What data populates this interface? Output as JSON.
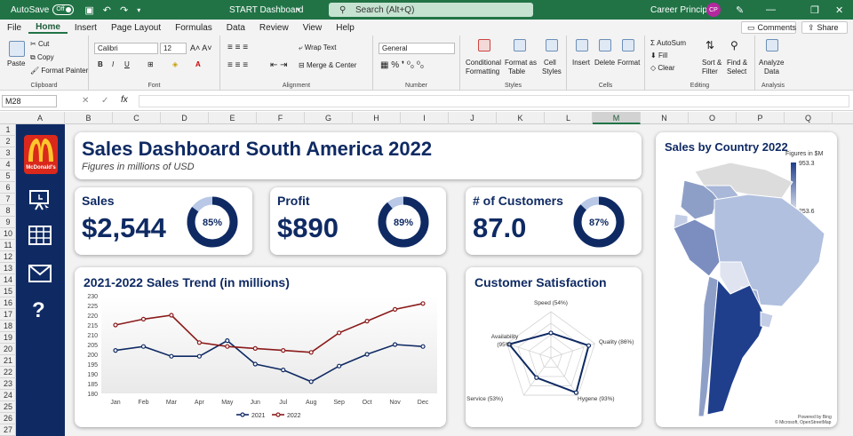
{
  "titlebar": {
    "autosave_label": "AutoSave",
    "autosave_state": "Off",
    "doc_title": "START Dashboard",
    "search_placeholder": "Search (Alt+Q)",
    "user_name": "Career Principles",
    "user_initials": "CP"
  },
  "menu": {
    "tabs": [
      "File",
      "Home",
      "Insert",
      "Page Layout",
      "Formulas",
      "Data",
      "Review",
      "View",
      "Help"
    ],
    "comments_label": "Comments",
    "share_label": "Share"
  },
  "ribbon": {
    "clipboard": {
      "paste": "Paste",
      "cut": "Cut",
      "copy": "Copy",
      "format_painter": "Format Painter",
      "label": "Clipboard"
    },
    "font": {
      "name": "Calibri",
      "size": "12",
      "label": "Font"
    },
    "alignment": {
      "wrap": "Wrap Text",
      "merge": "Merge & Center",
      "label": "Alignment"
    },
    "number": {
      "format": "General",
      "label": "Number"
    },
    "styles": {
      "cond1": "Conditional",
      "cond2": "Formatting",
      "fmt1": "Format as",
      "fmt2": "Table",
      "cell1": "Cell",
      "cell2": "Styles",
      "label": "Styles"
    },
    "cells": {
      "insert": "Insert",
      "delete": "Delete",
      "format": "Format",
      "label": "Cells"
    },
    "editing": {
      "autosum": "AutoSum",
      "fill": "Fill",
      "clear": "Clear",
      "sort1": "Sort &",
      "sort2": "Filter",
      "find1": "Find &",
      "find2": "Select",
      "label": "Editing"
    },
    "analysis": {
      "an1": "Analyze",
      "an2": "Data",
      "label": "Analysis"
    }
  },
  "formula_bar": {
    "cell_ref": "M28",
    "fx": "fx"
  },
  "columns": [
    "A",
    "B",
    "C",
    "D",
    "E",
    "F",
    "G",
    "H",
    "I",
    "J",
    "K",
    "L",
    "M",
    "N",
    "O",
    "P",
    "Q"
  ],
  "active_column": "M",
  "rows": [
    "1",
    "2",
    "3",
    "4",
    "5",
    "6",
    "7",
    "8",
    "9",
    "10",
    "11",
    "12",
    "13",
    "14",
    "15",
    "16",
    "17",
    "18",
    "19",
    "20",
    "21",
    "22",
    "23",
    "24",
    "25",
    "26",
    "27"
  ],
  "sidebar": {
    "logo_text": "McDonald's",
    "brand_red": "#da291c",
    "brand_yellow": "#ffc72c"
  },
  "header": {
    "title": "Sales Dashboard South America 2022",
    "subtitle": "Figures in millions of USD"
  },
  "kpis": [
    {
      "label": "Sales",
      "value": "$2,544",
      "pct": "85%",
      "fraction": 0.85
    },
    {
      "label": "Profit",
      "value": "$890",
      "pct": "89%",
      "fraction": 0.89
    },
    {
      "label": "# of Customers",
      "value": "87.0",
      "pct": "87%",
      "fraction": 0.87
    }
  ],
  "colors": {
    "navy": "#0f2a63",
    "maroon": "#8b1a1a",
    "light_blue": "#b8c8e6"
  },
  "chart_data": [
    {
      "type": "line",
      "title": "2021-2022 Sales Trend (in millions)",
      "categories": [
        "Jan",
        "Feb",
        "Mar",
        "Apr",
        "May",
        "Jun",
        "Jul",
        "Aug",
        "Sep",
        "Oct",
        "Nov",
        "Dec"
      ],
      "ylim": [
        180,
        230
      ],
      "yticks": [
        180,
        185,
        190,
        195,
        200,
        205,
        210,
        215,
        220,
        225,
        230
      ],
      "series": [
        {
          "name": "2021",
          "color": "#0f2a63",
          "values": [
            202,
            204,
            199,
            199,
            207,
            195,
            192,
            186,
            194,
            200,
            205,
            204
          ]
        },
        {
          "name": "2022",
          "color": "#8b1a1a",
          "values": [
            215,
            218,
            220,
            206,
            204,
            203,
            202,
            201,
            211,
            217,
            223,
            226
          ]
        }
      ]
    },
    {
      "type": "radar",
      "title": "Customer Satisfaction",
      "axes": [
        {
          "label": "Speed (54%)",
          "value": 0.54
        },
        {
          "label": "Quality (86%)",
          "value": 0.86
        },
        {
          "label": "Hygene (93%)",
          "value": 0.93
        },
        {
          "label": "Service (53%)",
          "value": 0.53
        },
        {
          "label": "Availability (95%)",
          "value": 0.95
        }
      ]
    },
    {
      "type": "map",
      "title": "Sales by Country 2022",
      "legend_title": "Figures in $M",
      "legend_max": "953.3",
      "legend_min": "253.6",
      "credit1": "Powered by Bing",
      "credit2": "© Microsoft, OpenStreetMap"
    }
  ]
}
